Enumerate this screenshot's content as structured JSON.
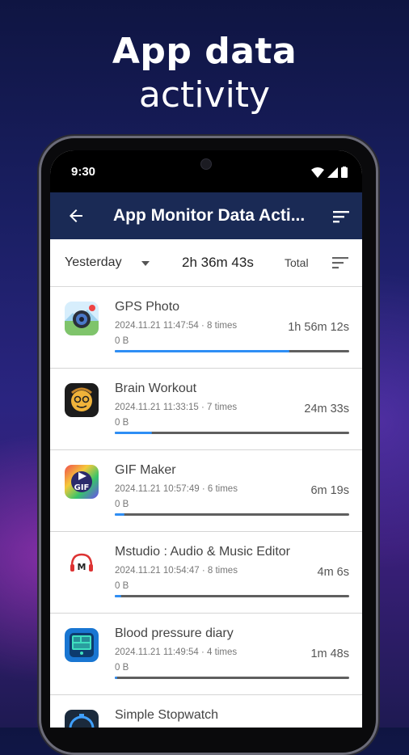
{
  "headline": {
    "line1": "App data",
    "line2": "activity"
  },
  "status": {
    "time": "9:30"
  },
  "appbar": {
    "title": "App Monitor Data Acti..."
  },
  "filter": {
    "period": "Yesterday",
    "total_time": "2h 36m 43s",
    "total_label": "Total"
  },
  "apps": [
    {
      "name": "GPS Photo",
      "meta": "2024.11.21 11:47:54 · 8 times",
      "duration": "1h 56m 12s",
      "bytes": "0 B",
      "fraction": 0.745,
      "icon": "gps-photo-icon"
    },
    {
      "name": "Brain Workout",
      "meta": "2024.11.21 11:33:15 · 7 times",
      "duration": "24m 33s",
      "bytes": "0 B",
      "fraction": 0.157,
      "icon": "brain-workout-icon"
    },
    {
      "name": "GIF Maker",
      "meta": "2024.11.21 10:57:49 · 6 times",
      "duration": "6m 19s",
      "bytes": "0 B",
      "fraction": 0.04,
      "icon": "gif-maker-icon"
    },
    {
      "name": "Mstudio : Audio & Music Editor",
      "meta": "2024.11.21 10:54:47 · 8 times",
      "duration": "4m 6s",
      "bytes": "0 B",
      "fraction": 0.026,
      "icon": "mstudio-icon"
    },
    {
      "name": "Blood pressure diary",
      "meta": "2024.11.21 11:49:54 · 4 times",
      "duration": "1m 48s",
      "bytes": "0 B",
      "fraction": 0.012,
      "icon": "blood-pressure-icon"
    },
    {
      "name": "Simple Stopwatch",
      "meta": "",
      "duration": "",
      "bytes": "",
      "fraction": 0,
      "icon": "stopwatch-icon"
    }
  ],
  "colors": {
    "appbar": "#1a2a55",
    "progress": "#2e8ef5",
    "track": "#5f5f5f"
  }
}
